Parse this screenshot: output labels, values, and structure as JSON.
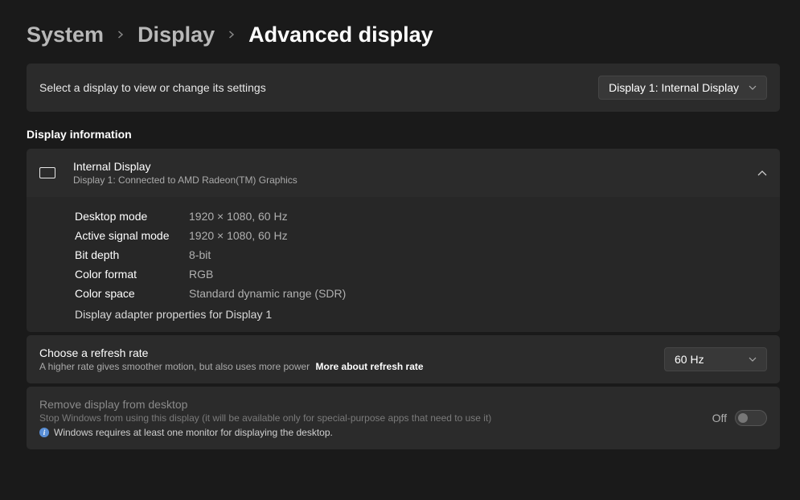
{
  "breadcrumb": {
    "system": "System",
    "display": "Display",
    "current": "Advanced display"
  },
  "selectDisplay": {
    "label": "Select a display to view or change its settings",
    "value": "Display 1: Internal Display"
  },
  "sectionHeader": "Display information",
  "displayInfo": {
    "title": "Internal Display",
    "subtitle": "Display 1: Connected to AMD Radeon(TM) Graphics",
    "rows": [
      {
        "key": "Desktop mode",
        "val": "1920 × 1080, 60 Hz"
      },
      {
        "key": "Active signal mode",
        "val": "1920 × 1080, 60 Hz"
      },
      {
        "key": "Bit depth",
        "val": "8-bit"
      },
      {
        "key": "Color format",
        "val": "RGB"
      },
      {
        "key": "Color space",
        "val": "Standard dynamic range (SDR)"
      }
    ],
    "adapterLink": "Display adapter properties for Display 1"
  },
  "refresh": {
    "title": "Choose a refresh rate",
    "sub": "A higher rate gives smoother motion, but also uses more power",
    "link": "More about refresh rate",
    "value": "60 Hz"
  },
  "remove": {
    "title": "Remove display from desktop",
    "sub": "Stop Windows from using this display (it will be available only for special-purpose apps that need to use it)",
    "info": "Windows requires at least one monitor for displaying the desktop.",
    "toggleLabel": "Off"
  }
}
